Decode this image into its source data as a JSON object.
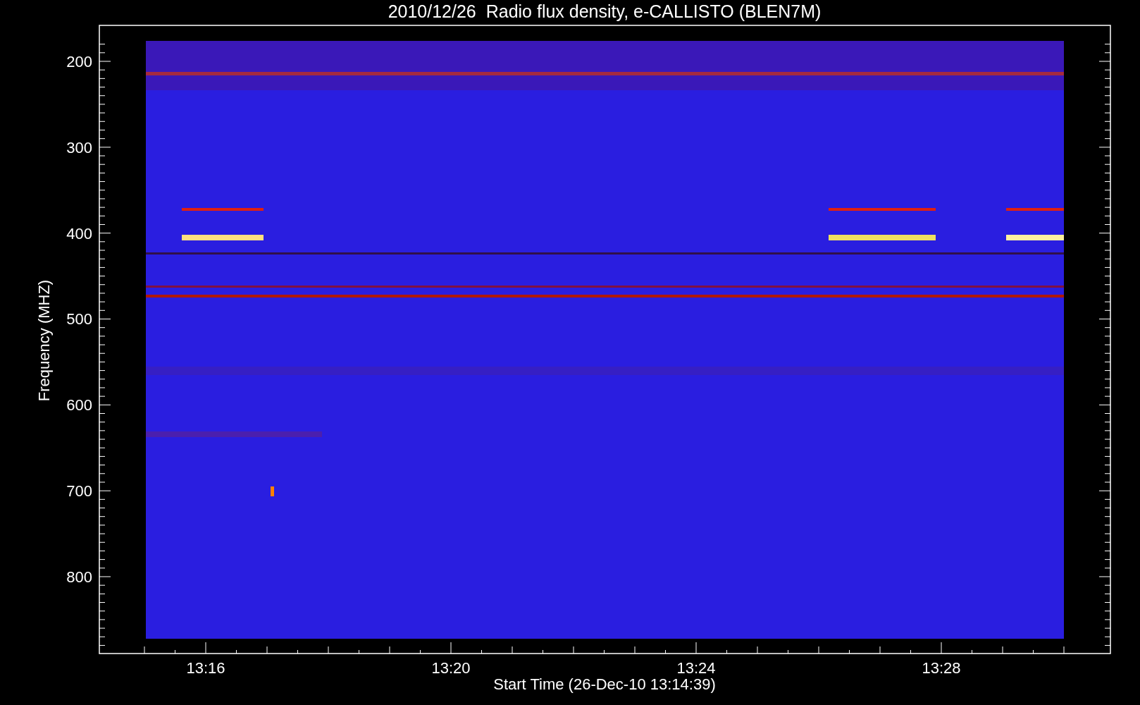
{
  "title": "2010/12/26  Radio flux density, e-CALLISTO (BLEN7M)",
  "y_axis": {
    "label": "Frequency (MHZ)",
    "tick_labels": [
      "200",
      "300",
      "400",
      "500",
      "600",
      "700",
      "800"
    ]
  },
  "x_axis": {
    "label": "Start Time (26-Dec-10 13:14:39)",
    "tick_labels": [
      "13:16",
      "13:20",
      "13:24",
      "13:28"
    ]
  }
}
